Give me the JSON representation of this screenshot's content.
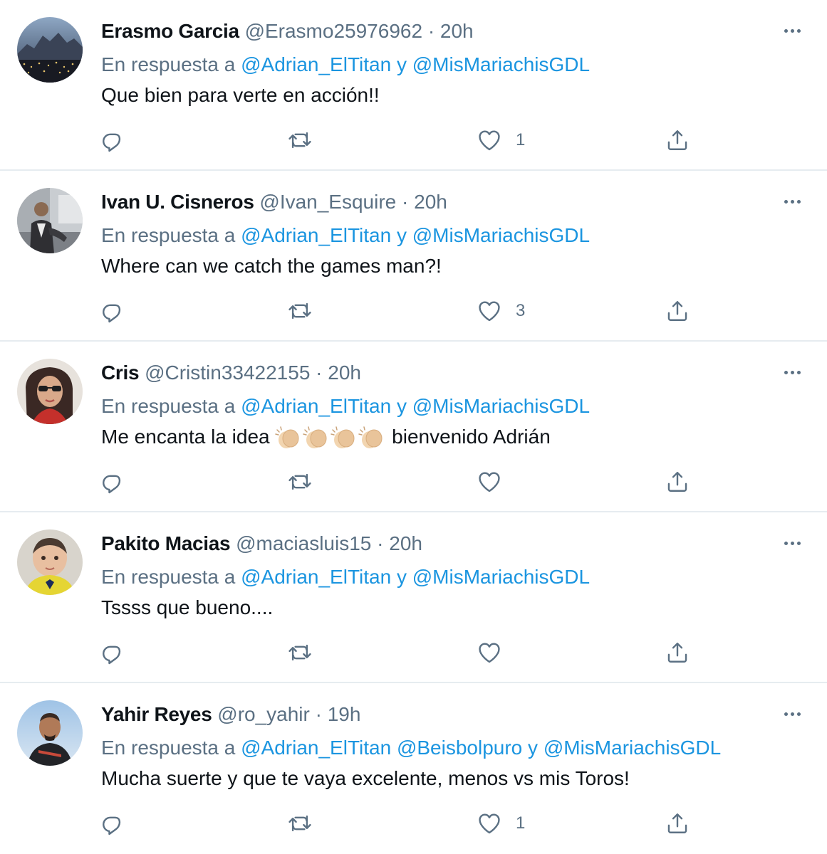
{
  "colors": {
    "link": "#1b95e0",
    "secondary_text": "#5b7083",
    "primary_text": "#0f1419",
    "divider": "#e6ecf0"
  },
  "icons": {
    "reply": "reply-icon",
    "retweet": "retweet-icon",
    "like": "heart-icon",
    "share": "share-icon",
    "more": "more-icon"
  },
  "tweets": [
    {
      "name": "Erasmo Garcia",
      "meta": "@Erasmo25976962 · 20h",
      "reply_prefix": "En respuesta a",
      "mention1": "@Adrian_ElTitan",
      "joiner": "y",
      "mention2": "@MisMariachisGDL",
      "text": "Que bien para verte en acción!!",
      "likes": "1"
    },
    {
      "name": "Ivan U. Cisneros",
      "meta": "@Ivan_Esquire · 20h",
      "reply_prefix": "En respuesta a",
      "mention1": "@Adrian_ElTitan",
      "joiner": "y",
      "mention2": "@MisMariachisGDL",
      "text": "Where can we catch the games man?!",
      "likes": "3"
    },
    {
      "name": "Cris",
      "meta": "@Cristin33422155 · 20h",
      "reply_prefix": "En respuesta a",
      "mention1": "@Adrian_ElTitan",
      "joiner": "y",
      "mention2": "@MisMariachisGDL",
      "text_before": "Me encanta la idea",
      "text_after": "bienvenido Adrián",
      "emoji": "👏👏👏👏",
      "likes": ""
    },
    {
      "name": "Pakito Macias",
      "meta": "@maciasluis15 · 20h",
      "reply_prefix": "En respuesta a",
      "mention1": "@Adrian_ElTitan",
      "joiner": "y",
      "mention2": "@MisMariachisGDL",
      "text": "Tssss que bueno....",
      "likes": ""
    },
    {
      "name": "Yahir Reyes",
      "meta": "@ro_yahir · 19h",
      "reply_prefix": "En respuesta a",
      "mention1": "@Adrian_ElTitan",
      "mention_mid": "@Beisbolpuro",
      "joiner": "y",
      "mention2": "@MisMariachisGDL",
      "text": "Mucha suerte y que te vaya excelente, menos vs mis Toros!",
      "likes": "1"
    }
  ]
}
